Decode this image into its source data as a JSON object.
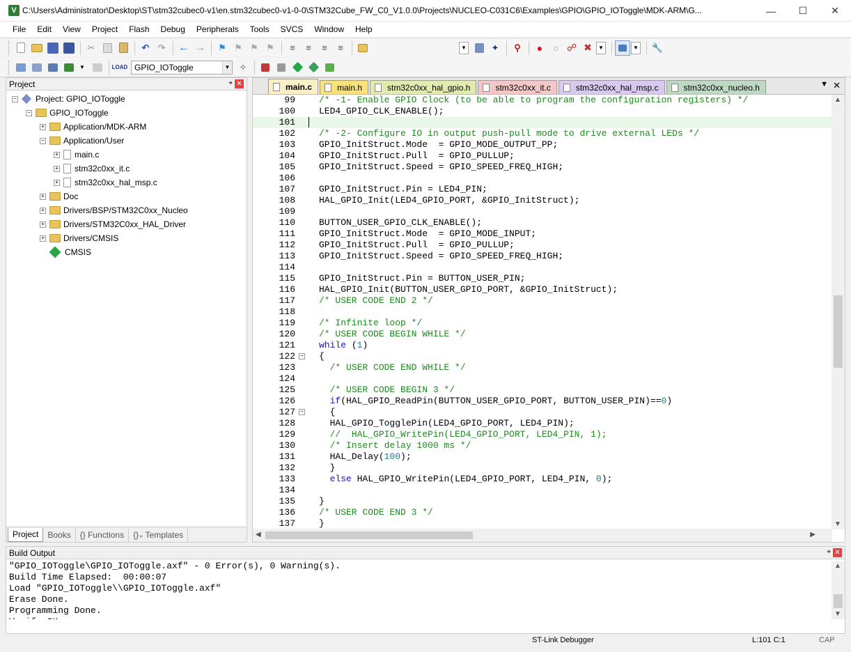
{
  "window": {
    "title": "C:\\Users\\Administrator\\Desktop\\ST\\stm32cubec0-v1\\en.stm32cubec0-v1-0-0\\STM32Cube_FW_C0_V1.0.0\\Projects\\NUCLEO-C031C6\\Examples\\GPIO\\GPIO_IOToggle\\MDK-ARM\\G...",
    "icon_label": "V"
  },
  "menu": [
    "File",
    "Edit",
    "View",
    "Project",
    "Flash",
    "Debug",
    "Peripherals",
    "Tools",
    "SVCS",
    "Window",
    "Help"
  ],
  "toolbar2": {
    "target": "GPIO_IOToggle"
  },
  "project_panel": {
    "title": "Project",
    "tree": [
      {
        "label": "Project: GPIO_IOToggle",
        "level": 0,
        "kind": "project",
        "expander": "−"
      },
      {
        "label": "GPIO_IOToggle",
        "level": 1,
        "kind": "target",
        "expander": "−"
      },
      {
        "label": "Application/MDK-ARM",
        "level": 2,
        "kind": "folder",
        "expander": "+"
      },
      {
        "label": "Application/User",
        "level": 2,
        "kind": "folder",
        "expander": "−"
      },
      {
        "label": "main.c",
        "level": 3,
        "kind": "file",
        "expander": "+"
      },
      {
        "label": "stm32c0xx_it.c",
        "level": 3,
        "kind": "file",
        "expander": "+"
      },
      {
        "label": "stm32c0xx_hal_msp.c",
        "level": 3,
        "kind": "file",
        "expander": "+"
      },
      {
        "label": "Doc",
        "level": 2,
        "kind": "folder",
        "expander": "+"
      },
      {
        "label": "Drivers/BSP/STM32C0xx_Nucleo",
        "level": 2,
        "kind": "folder",
        "expander": "+"
      },
      {
        "label": "Drivers/STM32C0xx_HAL_Driver",
        "level": 2,
        "kind": "folder",
        "expander": "+"
      },
      {
        "label": "Drivers/CMSIS",
        "level": 2,
        "kind": "folder",
        "expander": "+"
      },
      {
        "label": "CMSIS",
        "level": 2,
        "kind": "component",
        "expander": ""
      }
    ],
    "tabs": [
      "Project",
      "Books",
      "{} Functions",
      "{}₊ Templates"
    ]
  },
  "editor": {
    "tabs": [
      {
        "label": "main.c",
        "color": "#f9f0c8",
        "active": true
      },
      {
        "label": "main.h",
        "color": "#f9e27a",
        "active": false
      },
      {
        "label": "stm32c0xx_hal_gpio.h",
        "color": "#e3eab0",
        "active": false
      },
      {
        "label": "stm32c0xx_it.c",
        "color": "#f3c6c8",
        "active": false
      },
      {
        "label": "stm32c0xx_hal_msp.c",
        "color": "#d8c9ef",
        "active": false
      },
      {
        "label": "stm32c0xx_nucleo.h",
        "color": "#bfd8c4",
        "active": false
      }
    ],
    "current_line": 101,
    "lines": [
      {
        "n": "99",
        "indent": "",
        "parts": [
          [
            "c",
            "/* -1- Enable GPIO Clock (to be able to program the configuration registers) */"
          ]
        ]
      },
      {
        "n": "100",
        "indent": "",
        "parts": [
          [
            "t",
            "LED4_GPIO_CLK_ENABLE();"
          ]
        ]
      },
      {
        "n": "101",
        "indent": "",
        "parts": []
      },
      {
        "n": "102",
        "indent": "",
        "parts": [
          [
            "c",
            "/* -2- Configure IO in output push-pull mode to drive external LEDs */"
          ]
        ]
      },
      {
        "n": "103",
        "indent": "",
        "parts": [
          [
            "t",
            "GPIO_InitStruct.Mode  = GPIO_MODE_OUTPUT_PP;"
          ]
        ]
      },
      {
        "n": "104",
        "indent": "",
        "parts": [
          [
            "t",
            "GPIO_InitStruct.Pull  = GPIO_PULLUP;"
          ]
        ]
      },
      {
        "n": "105",
        "indent": "",
        "parts": [
          [
            "t",
            "GPIO_InitStruct.Speed = GPIO_SPEED_FREQ_HIGH;"
          ]
        ]
      },
      {
        "n": "106",
        "indent": "",
        "parts": []
      },
      {
        "n": "107",
        "indent": "",
        "parts": [
          [
            "t",
            "GPIO_InitStruct.Pin = LED4_PIN;"
          ]
        ]
      },
      {
        "n": "108",
        "indent": "",
        "parts": [
          [
            "t",
            "HAL_GPIO_Init(LED4_GPIO_PORT, &GPIO_InitStruct);"
          ]
        ]
      },
      {
        "n": "109",
        "indent": "",
        "parts": []
      },
      {
        "n": "110",
        "indent": "",
        "parts": [
          [
            "t",
            "BUTTON_USER_GPIO_CLK_ENABLE();"
          ]
        ]
      },
      {
        "n": "111",
        "indent": "",
        "parts": [
          [
            "t",
            "GPIO_InitStruct.Mode  = GPIO_MODE_INPUT;"
          ]
        ]
      },
      {
        "n": "112",
        "indent": "",
        "parts": [
          [
            "t",
            "GPIO_InitStruct.Pull  = GPIO_PULLUP;"
          ]
        ]
      },
      {
        "n": "113",
        "indent": "",
        "parts": [
          [
            "t",
            "GPIO_InitStruct.Speed = GPIO_SPEED_FREQ_HIGH;"
          ]
        ]
      },
      {
        "n": "114",
        "indent": "",
        "parts": []
      },
      {
        "n": "115",
        "indent": "",
        "parts": [
          [
            "t",
            "GPIO_InitStruct.Pin = BUTTON_USER_PIN;"
          ]
        ]
      },
      {
        "n": "116",
        "indent": "",
        "parts": [
          [
            "t",
            "HAL_GPIO_Init(BUTTON_USER_GPIO_PORT, &GPIO_InitStruct);"
          ]
        ]
      },
      {
        "n": "117",
        "indent": "",
        "parts": [
          [
            "c",
            "/* USER CODE END 2 */"
          ]
        ]
      },
      {
        "n": "118",
        "indent": "",
        "parts": []
      },
      {
        "n": "119",
        "indent": "",
        "parts": [
          [
            "c",
            "/* Infinite loop */"
          ]
        ]
      },
      {
        "n": "120",
        "indent": "",
        "parts": [
          [
            "c",
            "/* USER CODE BEGIN WHILE */"
          ]
        ]
      },
      {
        "n": "121",
        "indent": "",
        "parts": [
          [
            "k",
            "while"
          ],
          [
            "t",
            " ("
          ],
          [
            "n",
            "1"
          ],
          [
            "t",
            ")"
          ]
        ]
      },
      {
        "n": "122",
        "indent": "",
        "parts": [
          [
            "t",
            "{"
          ]
        ],
        "fold": "−"
      },
      {
        "n": "123",
        "indent": "  ",
        "parts": [
          [
            "c",
            "/* USER CODE END WHILE */"
          ]
        ]
      },
      {
        "n": "124",
        "indent": "",
        "parts": []
      },
      {
        "n": "125",
        "indent": "  ",
        "parts": [
          [
            "c",
            "/* USER CODE BEGIN 3 */"
          ]
        ]
      },
      {
        "n": "126",
        "indent": "  ",
        "parts": [
          [
            "k",
            "if"
          ],
          [
            "t",
            "(HAL_GPIO_ReadPin(BUTTON_USER_GPIO_PORT, BUTTON_USER_PIN)=="
          ],
          [
            "n",
            "0"
          ],
          [
            "t",
            ")"
          ]
        ]
      },
      {
        "n": "127",
        "indent": "  ",
        "parts": [
          [
            "t",
            "{"
          ]
        ],
        "fold": "−"
      },
      {
        "n": "128",
        "indent": "  ",
        "parts": [
          [
            "t",
            "HAL_GPIO_TogglePin(LED4_GPIO_PORT, LED4_PIN);"
          ]
        ]
      },
      {
        "n": "129",
        "indent": "  ",
        "parts": [
          [
            "c",
            "//  HAL_GPIO_WritePin(LED4_GPIO_PORT, LED4_PIN, 1);"
          ]
        ]
      },
      {
        "n": "130",
        "indent": "  ",
        "parts": [
          [
            "c",
            "/* Insert delay 1000 ms */"
          ]
        ]
      },
      {
        "n": "131",
        "indent": "  ",
        "parts": [
          [
            "t",
            "HAL_Delay("
          ],
          [
            "n",
            "100"
          ],
          [
            "t",
            ");"
          ]
        ]
      },
      {
        "n": "132",
        "indent": "  ",
        "parts": [
          [
            "t",
            "}"
          ]
        ]
      },
      {
        "n": "133",
        "indent": "  ",
        "parts": [
          [
            "k",
            "else"
          ],
          [
            "t",
            " HAL_GPIO_WritePin(LED4_GPIO_PORT, LED4_PIN, "
          ],
          [
            "n",
            "0"
          ],
          [
            "t",
            ");"
          ]
        ]
      },
      {
        "n": "134",
        "indent": "",
        "parts": []
      },
      {
        "n": "135",
        "indent": "",
        "parts": [
          [
            "t",
            "}"
          ]
        ]
      },
      {
        "n": "136",
        "indent": "",
        "parts": [
          [
            "c",
            "/* USER CODE END 3 */"
          ]
        ]
      },
      {
        "n": "137",
        "indent": "",
        "parts": [
          [
            "t",
            "}"
          ]
        ]
      }
    ]
  },
  "build_output": {
    "title": "Build Output",
    "lines": [
      "\"GPIO_IOToggle\\GPIO_IOToggle.axf\" - 0 Error(s), 0 Warning(s).",
      "Build Time Elapsed:  00:00:07",
      "Load \"GPIO_IOToggle\\\\GPIO_IOToggle.axf\"",
      "Erase Done.",
      "Programming Done.",
      "Verify OK."
    ]
  },
  "status": {
    "debugger": "ST-Link Debugger",
    "position": "L:101 C:1",
    "caps": "CAP"
  },
  "colors": {
    "comment": "#1e8a1e",
    "keyword": "#1515d0",
    "number": "#1a7a8a",
    "current_line": "#e8f7e8"
  }
}
